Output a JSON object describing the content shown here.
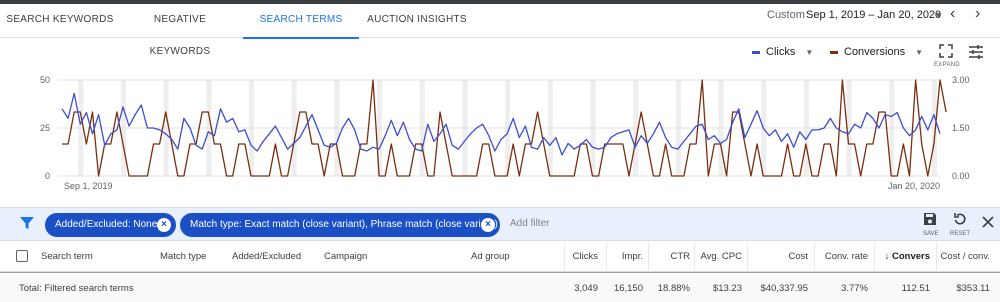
{
  "tabs": [
    {
      "label": "SEARCH KEYWORDS",
      "active": false
    },
    {
      "label": "NEGATIVE KEYWORDS",
      "active": false
    },
    {
      "label": "SEARCH TERMS",
      "active": true
    },
    {
      "label": "AUCTION INSIGHTS",
      "active": false
    }
  ],
  "date_range": {
    "label": "Custom",
    "value": "Sep 1, 2019 – Jan 20, 2020"
  },
  "controls": {
    "metric1": "Clicks",
    "metric2": "Conversions",
    "expand_label": "EXPAND",
    "metric1_color": "#3b4fd1",
    "metric2_color": "#7a2e0e"
  },
  "chart_data": {
    "type": "line",
    "x_start_label": "Sep 1, 2019",
    "x_end_label": "Jan 20, 2020",
    "y_left": {
      "ticks": [
        "50",
        "25",
        "0"
      ],
      "range": [
        0,
        50
      ]
    },
    "y_right": {
      "ticks": [
        "3.00",
        "1.50",
        "0.00"
      ],
      "range": [
        0,
        3
      ]
    },
    "series": [
      {
        "name": "Clicks",
        "axis": "left",
        "color": "#3b4fd1",
        "values": [
          35,
          30,
          43,
          27,
          33,
          22,
          32,
          16,
          22,
          24,
          36,
          26,
          32,
          37,
          25,
          25,
          24,
          22,
          19,
          14,
          30,
          25,
          16,
          14,
          23,
          21,
          35,
          28,
          30,
          23,
          24,
          16,
          13,
          18,
          22,
          26,
          20,
          14,
          17,
          20,
          26,
          32,
          24,
          16,
          15,
          17,
          25,
          30,
          24,
          14,
          13,
          15,
          14,
          21,
          29,
          21,
          28,
          19,
          14,
          13,
          27,
          18,
          22,
          27,
          16,
          14,
          18,
          22,
          25,
          27,
          21,
          13,
          19,
          22,
          30,
          20,
          26,
          15,
          14,
          20,
          16,
          20,
          11,
          17,
          14,
          16,
          19,
          15,
          14,
          15,
          20,
          22,
          23,
          24,
          15,
          21,
          17,
          22,
          28,
          20,
          15,
          14,
          18,
          22,
          26,
          27,
          19,
          21,
          17,
          19,
          28,
          35,
          20,
          27,
          34,
          25,
          21,
          24,
          18,
          22,
          15,
          23,
          19,
          24,
          24,
          25,
          30,
          25,
          23,
          22,
          27,
          25,
          33,
          30,
          25,
          32,
          31,
          33,
          25,
          21,
          24,
          31,
          24,
          32,
          22
        ]
      },
      {
        "name": "Conversions",
        "axis": "right",
        "color": "#7a2e0e",
        "values": [
          1,
          1,
          2,
          2,
          1,
          2,
          0,
          1,
          1,
          2,
          1,
          0,
          0,
          0,
          0,
          1,
          1,
          2,
          1,
          0,
          0,
          1,
          1,
          2,
          2,
          1,
          1,
          0,
          0,
          1,
          1,
          0,
          0,
          0,
          0,
          1,
          0,
          0,
          1,
          2,
          2,
          1,
          1,
          0,
          1,
          1,
          0,
          0,
          0,
          1,
          1,
          3,
          0,
          0,
          1,
          0,
          0,
          0,
          1,
          1,
          0,
          0,
          2,
          1,
          0,
          0,
          0,
          0,
          0,
          1,
          1,
          0,
          0,
          0,
          1,
          0,
          1,
          1,
          2,
          1,
          0,
          0,
          0,
          0,
          0,
          1,
          1,
          0,
          0,
          1,
          1,
          1,
          1,
          0,
          1,
          2,
          1,
          0,
          0,
          1,
          0,
          0,
          0,
          1,
          1,
          3,
          0,
          1,
          1,
          0,
          2,
          2,
          1,
          0,
          1,
          0,
          0,
          0,
          0,
          1,
          0,
          0,
          1,
          0,
          0,
          1,
          1,
          0,
          3,
          1,
          1,
          0,
          1,
          1,
          2,
          2,
          0,
          0,
          1,
          0,
          3,
          1,
          0,
          1,
          3,
          2
        ]
      }
    ]
  },
  "filters": {
    "chips": [
      "Added/Excluded: None",
      "Match type: Exact match (close variant), Phrase match (close variant)"
    ],
    "add_filter": "Add filter",
    "save_label": "SAVE",
    "reset_label": "RESET"
  },
  "table": {
    "headers": [
      "Search term",
      "Match type",
      "Added/Excluded",
      "Campaign",
      "Ad group",
      "Clicks",
      "Impr.",
      "CTR",
      "Avg. CPC",
      "Cost",
      "Conv. rate",
      "Convers",
      "Cost / conv."
    ],
    "total_row": {
      "label": "Total: Filtered search terms",
      "clicks": "3,049",
      "impr": "16,150",
      "ctr": "18.88%",
      "avg_cpc": "$13.23",
      "cost": "$40,337.95",
      "conv_rate": "3.77%",
      "conversions": "112.51",
      "cost_per_conv": "$353.11"
    }
  }
}
